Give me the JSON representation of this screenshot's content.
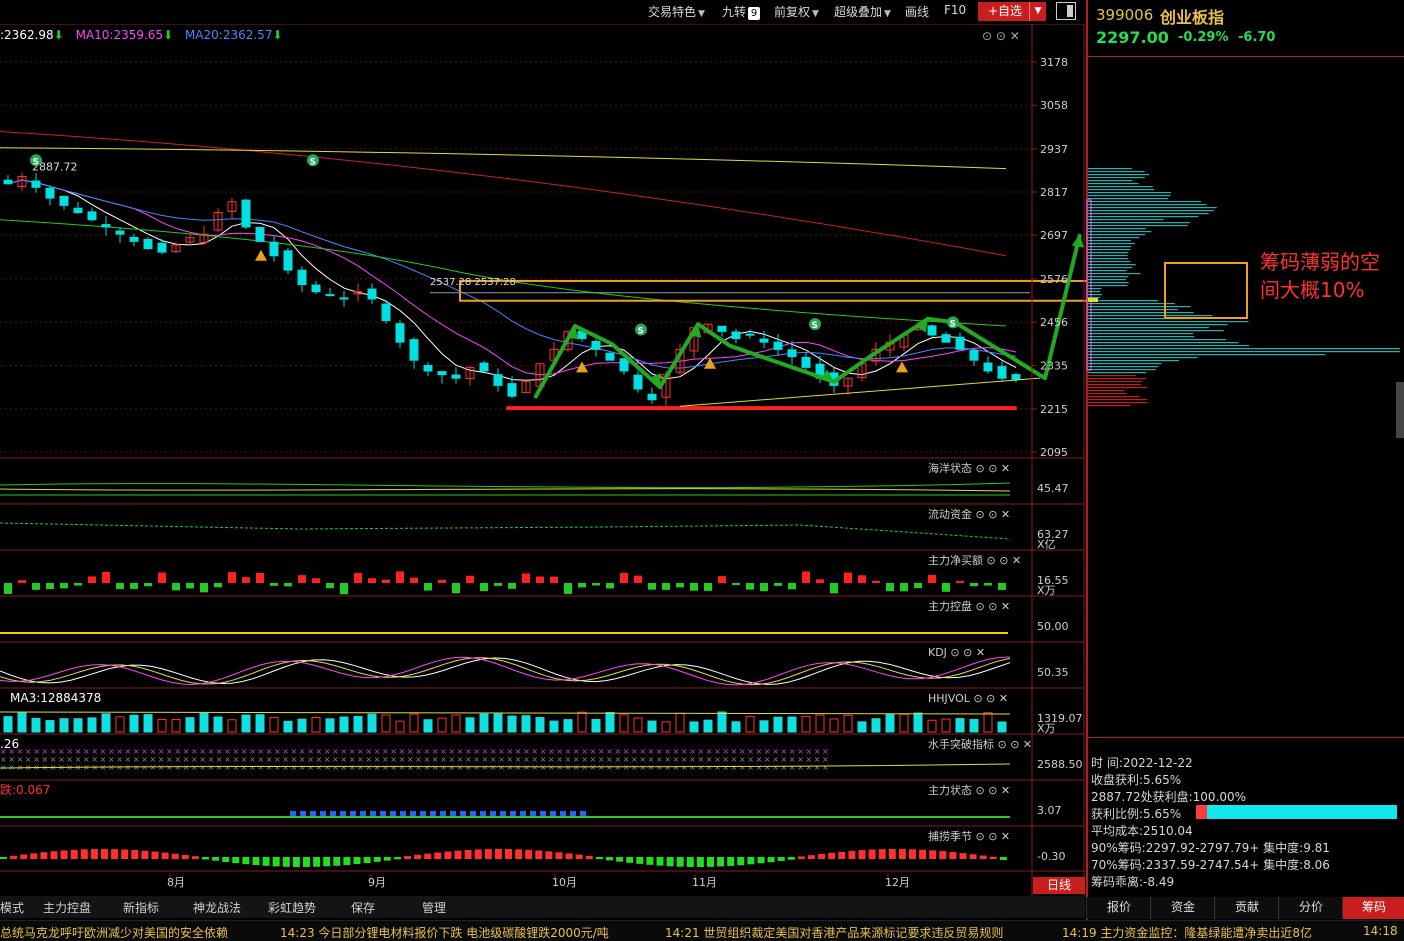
{
  "toolbar": {
    "items": [
      "交易特色",
      "九转",
      "前复权",
      "超级叠加",
      "画线",
      "F10"
    ],
    "jiuzhuan_badge": "9",
    "add_label": "+自选"
  },
  "quote": {
    "code": "399006",
    "name": "创业板指",
    "price": "2297.00",
    "change_pct": "-0.29%",
    "change": "-6.70"
  },
  "ma_legend": {
    "ma5": ":2362.98",
    "ma10": "MA10:2359.65",
    "ma20": "MA20:2362.57"
  },
  "annotations": {
    "high_label": "2887.72",
    "level_label": "2537.28  2537.28",
    "callout": "筹码薄弱的空间大概10%",
    "callout_lines": [
      "筹码薄弱的空",
      "间大概10%"
    ]
  },
  "price_axis": [
    "3178",
    "3058",
    "2937",
    "2817",
    "2697",
    "2576",
    "2456",
    "2335",
    "2215",
    "2095"
  ],
  "panels": [
    {
      "name": "海洋状态",
      "value": "45.47"
    },
    {
      "name": "流动资金",
      "value": "63.27",
      "unit": "X亿"
    },
    {
      "name": "主力净买额",
      "value": "16.55",
      "unit": "X万"
    },
    {
      "name": "主力控盘",
      "value": "50.00"
    },
    {
      "name": "KDJ",
      "value": "50.35"
    },
    {
      "name": "HHJVOL",
      "value": "1319.07",
      "unit": "X万",
      "legend": "MA3:12884378"
    },
    {
      "name": "水手突破指标",
      "value": "2588.50",
      "legend": ".26"
    },
    {
      "name": "主力状态",
      "value": "3.07",
      "legend": "跌:0.067"
    },
    {
      "name": "捕捞季节",
      "value": "-0.30"
    }
  ],
  "months": [
    "8月",
    "9月",
    "10月",
    "11月",
    "12月"
  ],
  "daily_label": "日线",
  "chips_info": {
    "time": "时        间:2022-12-22",
    "profit": "收盘获利:5.65%",
    "profit_line": "2887.72处获利盘:100.00%",
    "profit_ratio": "获利比例:5.65%",
    "avg_cost": "平均成本:2510.04",
    "chip90": "90%筹码:2297.92-2797.79+ 集中度:9.81",
    "chip70": "70%筹码:2337.59-2747.54+ 集中度:8.06",
    "deviation": "筹码乖离:-8.49",
    "profit_ratio_value": 0.0565
  },
  "right_tabs": [
    "报价",
    "资金",
    "贡献",
    "分价",
    "筹码"
  ],
  "bottom_tabs": [
    "模式",
    "主力控盘",
    "新指标",
    "神龙战法",
    "彩虹趋势",
    "保存",
    "管理"
  ],
  "ticker": [
    "总统马克龙呼吁欧洲减少对美国的安全依赖",
    "14:23  今日部分锂电材料报价下跌 电池级碳酸锂跌2000元/吨",
    "14:21  世贸组织裁定美国对香港产品来源标记要求违反贸易规则",
    "14:19  主力资金监控：隆基绿能遭净卖出近8亿",
    "14:18"
  ],
  "colors": {
    "up": "#ff3030",
    "down": "#00e0e0",
    "ma5": "#ffffff",
    "ma10": "#ff44ff",
    "ma20": "#4488ff",
    "ma60": "#22cc22",
    "ma120": "#cc2222",
    "ma250": "#dddd33",
    "arrow": "#22aa22",
    "box": "#f0a020"
  },
  "chart_data": {
    "type": "candlestick",
    "title": "创业板指 399006",
    "y_axis_ticks": [
      3178,
      3058,
      2937,
      2817,
      2697,
      2576,
      2456,
      2335,
      2215,
      2095
    ],
    "high_marker": 2887.72,
    "resistance_level": 2537.28,
    "last_close": 2297.0,
    "ma_values": {
      "ma5": 2362.98,
      "ma10": 2359.65,
      "ma20": 2362.57
    },
    "close_series_approx": [
      2840,
      2860,
      2830,
      2800,
      2780,
      2760,
      2740,
      2720,
      2700,
      2680,
      2660,
      2650,
      2670,
      2690,
      2700,
      2760,
      2790,
      2720,
      2680,
      2640,
      2600,
      2560,
      2540,
      2530,
      2520,
      2540,
      2520,
      2460,
      2400,
      2350,
      2320,
      2310,
      2300,
      2330,
      2320,
      2280,
      2250,
      2290,
      2340,
      2380,
      2430,
      2410,
      2380,
      2350,
      2320,
      2270,
      2240,
      2310,
      2380,
      2440,
      2450,
      2430,
      2410,
      2420,
      2400,
      2380,
      2360,
      2330,
      2300,
      2280,
      2300,
      2340,
      2380,
      2400,
      2420,
      2440,
      2420,
      2400,
      2380,
      2350,
      2320,
      2300,
      2297
    ]
  }
}
